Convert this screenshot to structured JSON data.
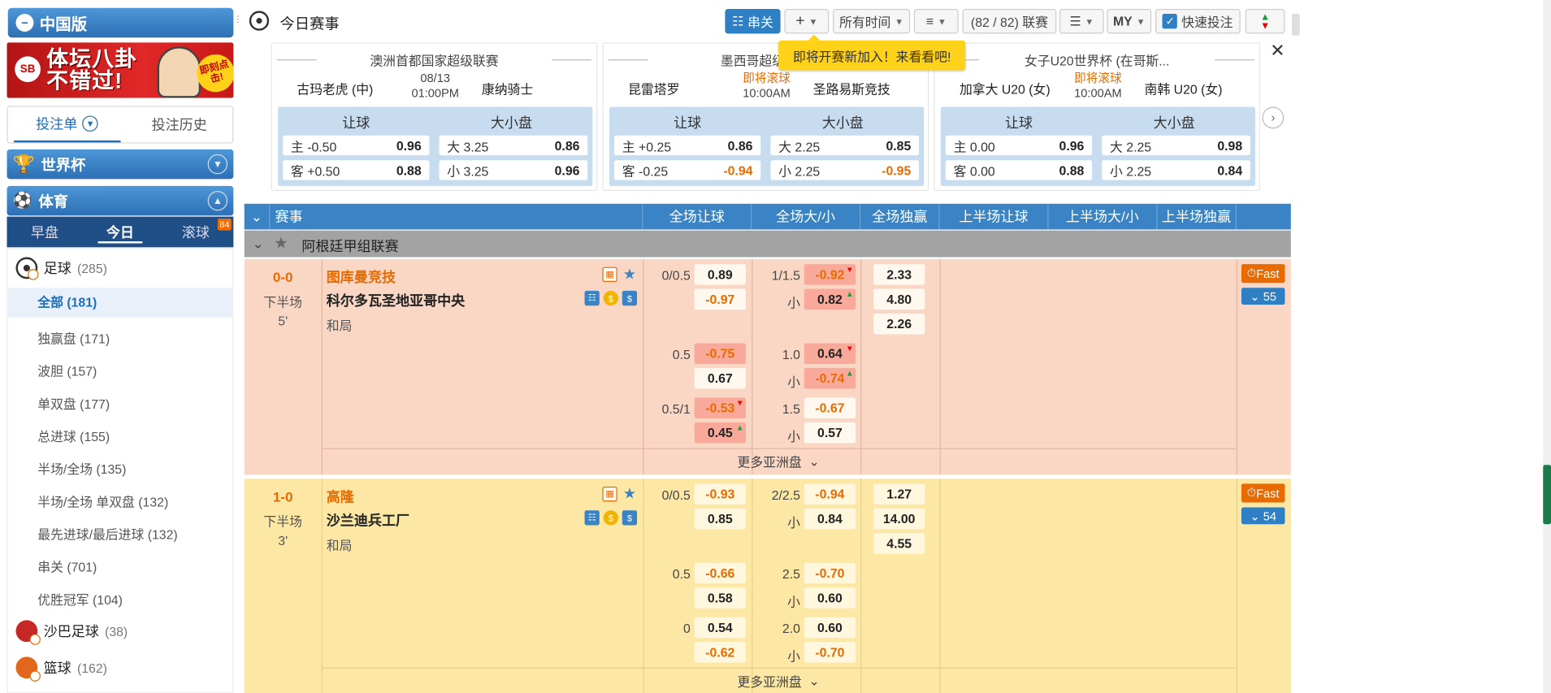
{
  "sidebar": {
    "region_label": "中国版",
    "banner_text": "体坛八卦\n不错过!",
    "banner_badge": "即刻点击!",
    "bet_tabs": [
      "投注单",
      "投注历史"
    ],
    "worldcup_label": "世界杯",
    "sport_label": "体育",
    "time_tabs": [
      "早盘",
      "今日",
      "滚球"
    ],
    "live_count": "84",
    "sports": [
      {
        "name": "足球",
        "count": "(285)"
      },
      {
        "name": "沙巴足球",
        "count": "(38)"
      },
      {
        "name": "篮球",
        "count": "(162)"
      }
    ],
    "soccer_sub": [
      {
        "name": "全部",
        "count": "(181)"
      },
      {
        "name": "独赢盘",
        "count": "(171)"
      },
      {
        "name": "波胆",
        "count": "(157)"
      },
      {
        "name": "单双盘",
        "count": "(177)"
      },
      {
        "name": "总进球",
        "count": "(155)"
      },
      {
        "name": "半场/全场",
        "count": "(135)"
      },
      {
        "name": "半场/全场 单双盘",
        "count": "(132)"
      },
      {
        "name": "最先进球/最后进球",
        "count": "(132)"
      },
      {
        "name": "串关",
        "count": "(701)"
      },
      {
        "name": "优胜冠军",
        "count": "(104)"
      }
    ]
  },
  "header": {
    "title": "今日赛事",
    "parlay_btn": "串关",
    "time_filter": "所有时间",
    "league_count": "(82 / 82) 联赛",
    "odds_format": "MY",
    "quick_bet": "快速投注",
    "tooltip": "即将开赛新加入！来看看吧!"
  },
  "featured": [
    {
      "league": "澳洲首都国家超级联赛",
      "home": "古玛老虎 (中)",
      "away": "康纳骑士",
      "date": "08/13",
      "time": "01:00PM",
      "status": "",
      "hdp_label": "让球",
      "ou_label": "大小盘",
      "hdp": [
        {
          "side": "主",
          "line": "-0.50",
          "odds": "0.96"
        },
        {
          "side": "客",
          "line": "+0.50",
          "odds": "0.88"
        }
      ],
      "ou": [
        {
          "side": "大",
          "line": "3.25",
          "odds": "0.86"
        },
        {
          "side": "小",
          "line": "3.25",
          "odds": "0.96"
        }
      ]
    },
    {
      "league": "墨西哥超级联赛",
      "home": "昆雷塔罗",
      "away": "圣路易斯竞技",
      "date": "即将滚球",
      "time": "10:00AM",
      "status": "live",
      "hdp_label": "让球",
      "ou_label": "大小盘",
      "hdp": [
        {
          "side": "主",
          "line": "+0.25",
          "odds": "0.86"
        },
        {
          "side": "客",
          "line": "-0.25",
          "odds": "-0.94"
        }
      ],
      "ou": [
        {
          "side": "大",
          "line": "2.25",
          "odds": "0.85"
        },
        {
          "side": "小",
          "line": "2.25",
          "odds": "-0.95"
        }
      ]
    },
    {
      "league": "女子U20世界杯 (在哥斯...",
      "home": "加拿大 U20 (女)",
      "away": "南韩 U20 (女)",
      "date": "即将滚球",
      "time": "10:00AM",
      "status": "live",
      "hdp_label": "让球",
      "ou_label": "大小盘",
      "hdp": [
        {
          "side": "主",
          "line": "0.00",
          "odds": "0.96"
        },
        {
          "side": "客",
          "line": "0.00",
          "odds": "0.88"
        }
      ],
      "ou": [
        {
          "side": "大",
          "line": "2.25",
          "odds": "0.98"
        },
        {
          "side": "小",
          "line": "2.25",
          "odds": "0.84"
        }
      ]
    }
  ],
  "table": {
    "columns": [
      "赛事",
      "全场让球",
      "全场大/小",
      "全场独赢",
      "上半场让球",
      "上半场大/小",
      "上半场独赢"
    ],
    "league": "阿根廷甲组联赛",
    "more_label": "更多亚洲盘",
    "matches": [
      {
        "score": "0-0",
        "period": "下半场",
        "minute": "5'",
        "home": "图库曼竞技",
        "away": "科尔多瓦圣地亚哥中央",
        "draw": "和局",
        "more_count": "55",
        "fast": "Fast",
        "hdp": [
          {
            "line": "0/0.5",
            "home": "0.89",
            "away": "-0.97"
          },
          {
            "line": "0.5",
            "home": "-0.75",
            "away": "0.67"
          },
          {
            "line": "0.5/1",
            "home": "-0.53",
            "away": "0.45"
          }
        ],
        "ou": [
          {
            "line": "1/1.5",
            "over": "-0.92",
            "under_label": "小",
            "under": "0.82"
          },
          {
            "line": "1.0",
            "over": "0.64",
            "under_label": "小",
            "under": "-0.74"
          },
          {
            "line": "1.5",
            "over": "-0.67",
            "under_label": "小",
            "under": "0.57"
          }
        ],
        "x12": [
          "2.33",
          "4.80",
          "2.26"
        ]
      },
      {
        "score": "1-0",
        "period": "下半场",
        "minute": "3'",
        "home": "高隆",
        "away": "沙兰迪兵工厂",
        "draw": "和局",
        "more_count": "54",
        "fast": "Fast",
        "hdp": [
          {
            "line": "0/0.5",
            "home": "-0.93",
            "away": "0.85"
          },
          {
            "line": "0.5",
            "home": "-0.66",
            "away": "0.58"
          },
          {
            "line": "0",
            "home": "0.54",
            "away": "-0.62"
          }
        ],
        "ou": [
          {
            "line": "2/2.5",
            "over": "-0.94",
            "under_label": "小",
            "under": "0.84"
          },
          {
            "line": "2.5",
            "over": "-0.70",
            "under_label": "小",
            "under": "0.60"
          },
          {
            "line": "2.0",
            "over": "0.60",
            "under_label": "小",
            "under": "-0.70"
          }
        ],
        "x12": [
          "1.27",
          "14.00",
          "4.55"
        ]
      }
    ]
  }
}
